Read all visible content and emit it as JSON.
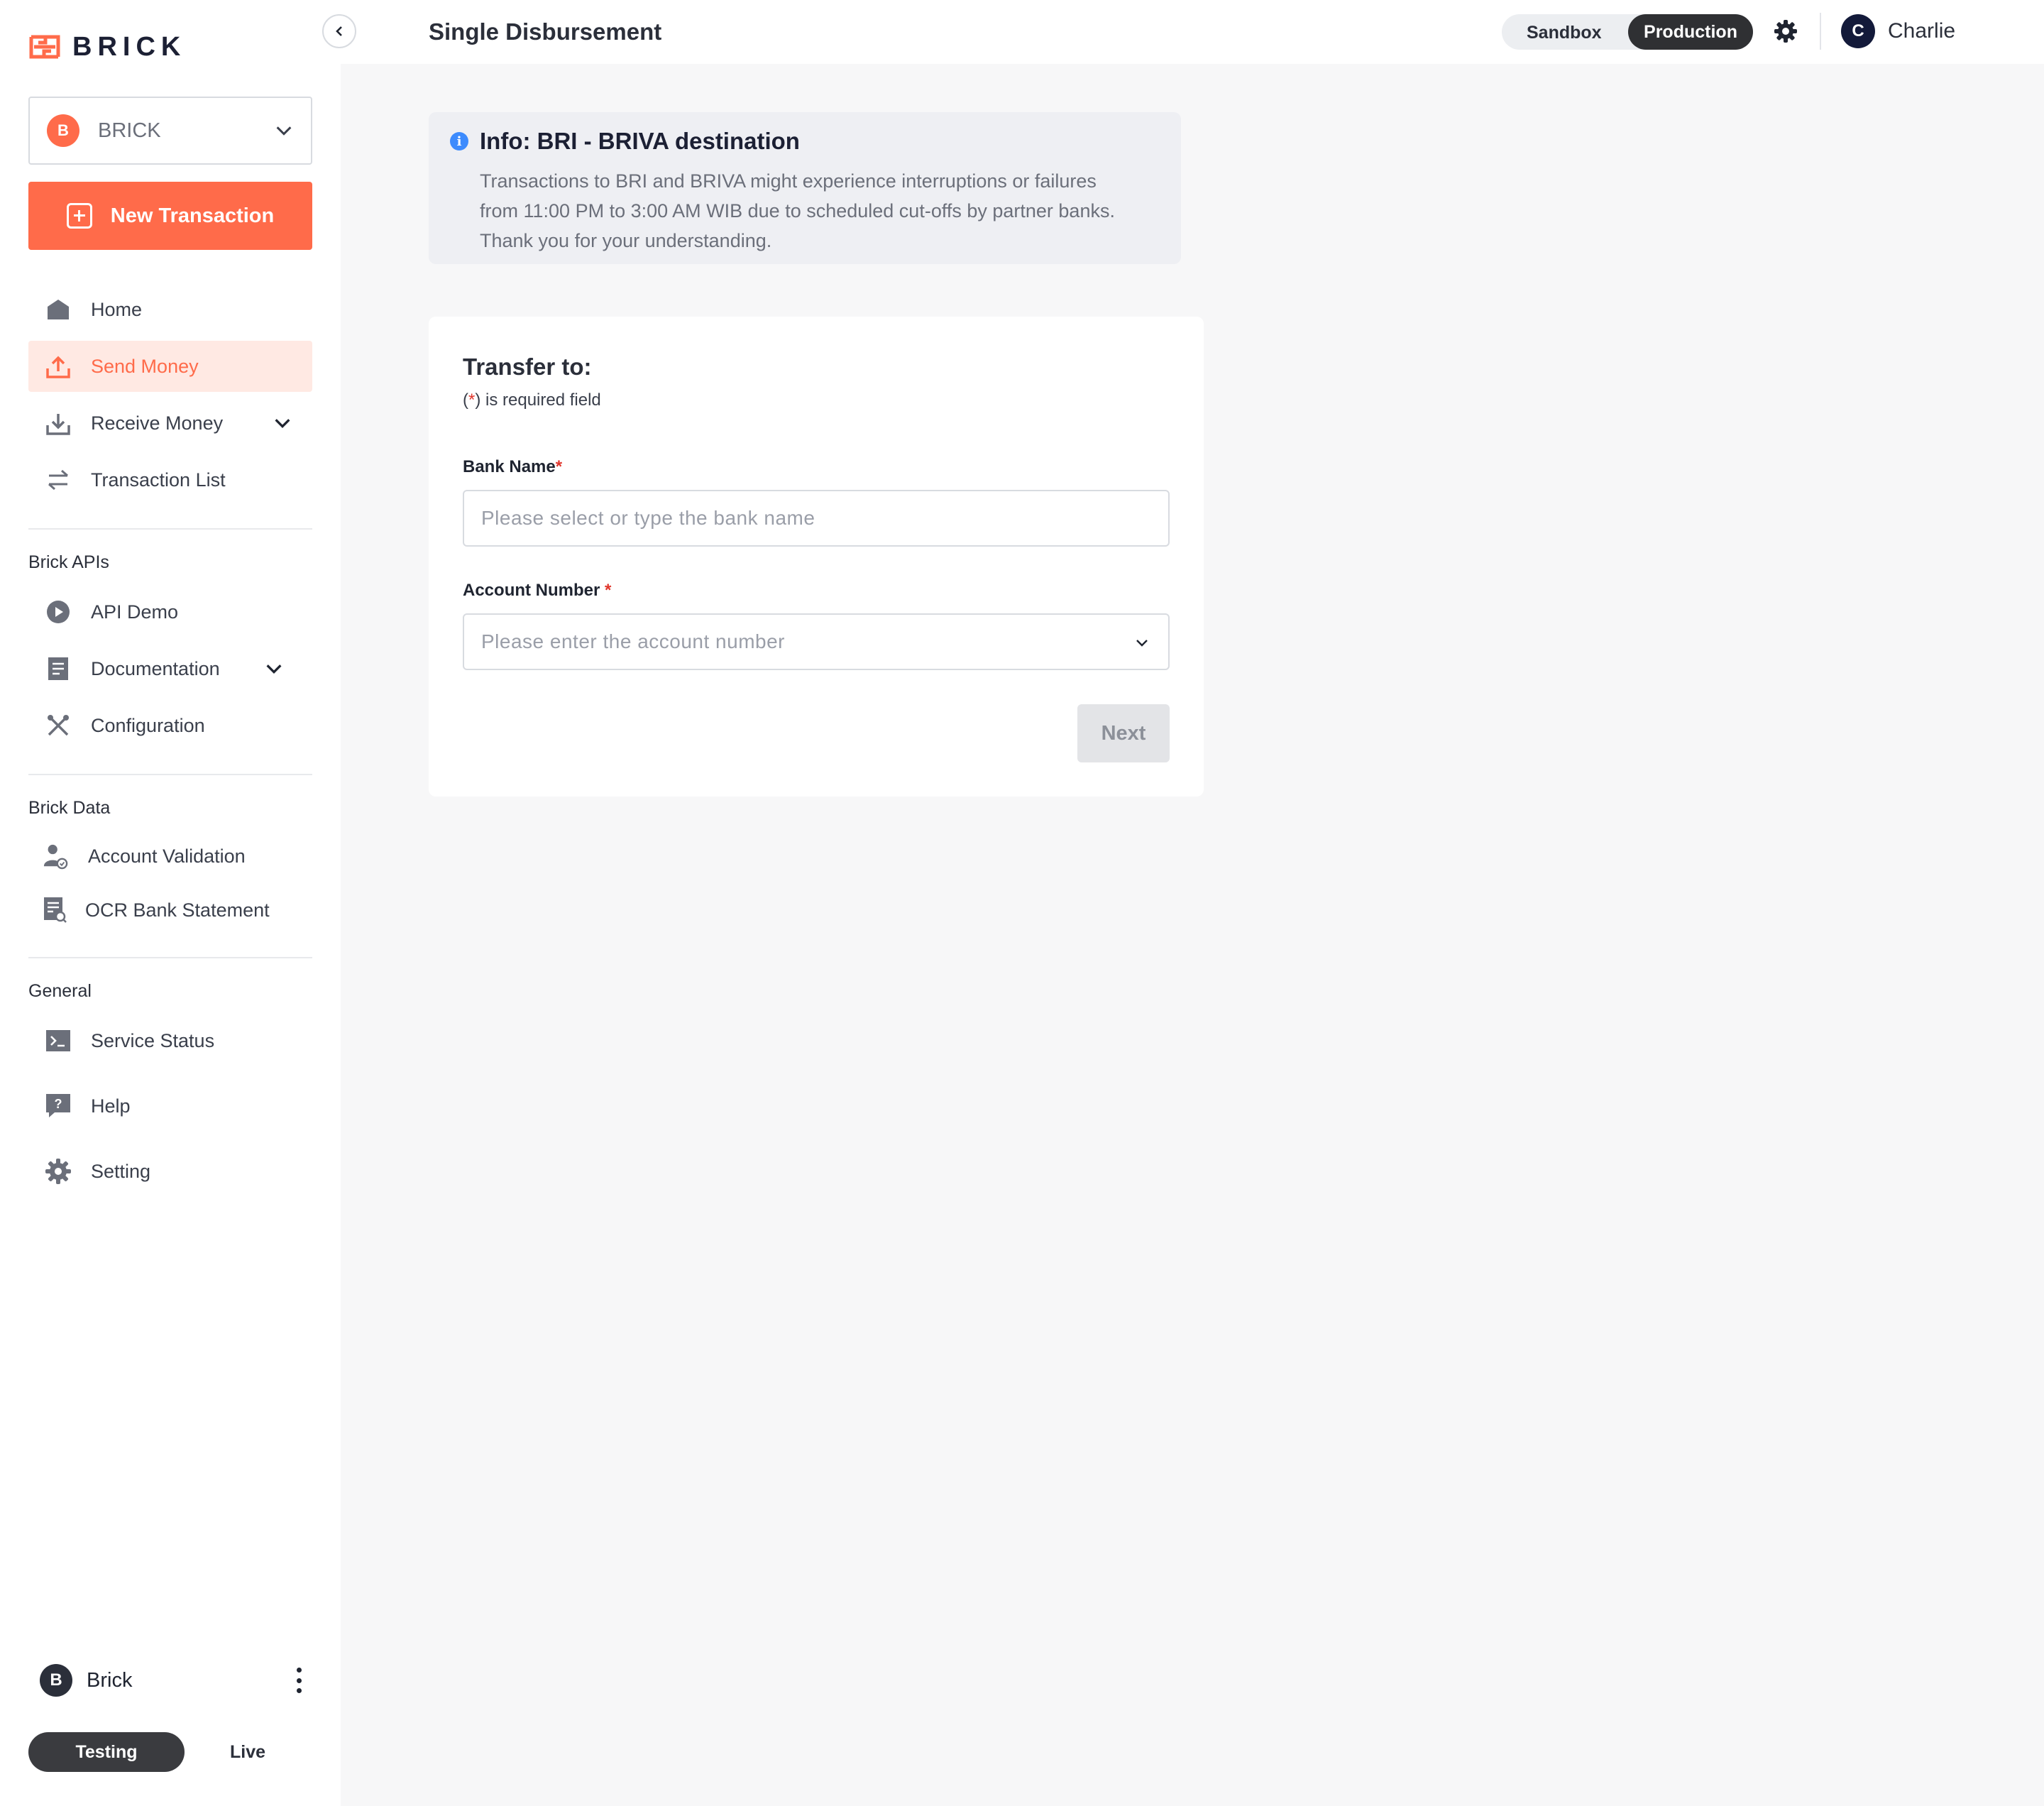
{
  "brand": {
    "logo_text": "BRICK",
    "accent_color": "#ff6b4a"
  },
  "org_select": {
    "avatar_letter": "B",
    "name": "BRICK"
  },
  "new_transaction": {
    "label": "New Transaction"
  },
  "nav": {
    "home": "Home",
    "send_money": "Send Money",
    "receive_money": "Receive Money",
    "transaction_list": "Transaction List"
  },
  "sections": {
    "brick_apis": {
      "title": "Brick APIs",
      "items": [
        "API Demo",
        "Documentation",
        "Configuration"
      ]
    },
    "brick_data": {
      "title": "Brick Data",
      "items": [
        "Account Validation",
        "OCR Bank Statement"
      ]
    },
    "general": {
      "title": "General",
      "items": [
        "Service Status",
        "Help",
        "Setting"
      ]
    }
  },
  "sidebar_footer": {
    "user_letter": "B",
    "user_name": "Brick",
    "mode_active": "Testing",
    "mode_other": "Live"
  },
  "header": {
    "title": "Single Disbursement",
    "env_sandbox": "Sandbox",
    "env_production": "Production",
    "env_active": "Production",
    "user_letter": "C",
    "user_name": "Charlie"
  },
  "info": {
    "title": "Info: BRI - BRIVA destination",
    "line1": "Transactions to BRI and BRIVA might experience interruptions or failures",
    "line2": "from 11:00 PM to 3:00 AM WIB due to scheduled cut-offs by partner banks.",
    "line3": "Thank you for your understanding."
  },
  "form": {
    "title": "Transfer to:",
    "required_open": "(",
    "required_star": "*",
    "required_close": ") is required field",
    "bank_label": "Bank Name",
    "bank_placeholder": "Please select or type the bank name",
    "account_label": "Account Number",
    "account_placeholder": "Please enter the account number",
    "star": "*",
    "next_label": "Next"
  }
}
